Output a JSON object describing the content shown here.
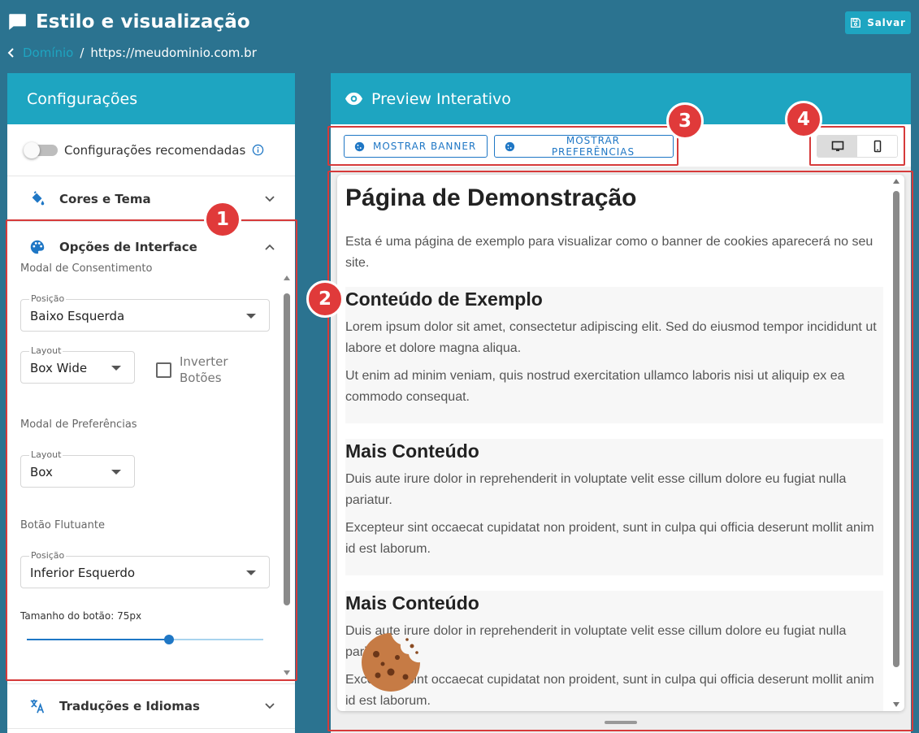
{
  "header": {
    "title": "Estilo e visualização",
    "save_label": "Salvar",
    "breadcrumb": {
      "link": "Domínio",
      "separator": "/",
      "current": "https://meudominio.com.br"
    }
  },
  "config_panel": {
    "title": "Configurações",
    "recommended_label": "Configurações recomendadas",
    "colors_label": "Cores e Tema",
    "interface": {
      "label": "Opções de Interface",
      "consent_modal": {
        "label": "Modal de Consentimento",
        "position_legend": "Posição",
        "position_value": "Baixo Esquerda",
        "layout_legend": "Layout",
        "layout_value": "Box Wide",
        "invert_label_1": "Inverter",
        "invert_label_2": "Botões"
      },
      "preferences_modal": {
        "label": "Modal de Preferências",
        "layout_legend": "Layout",
        "layout_value": "Box"
      },
      "floating_button": {
        "label": "Botão Flutuante",
        "position_legend": "Posição",
        "position_value": "Inferior Esquerdo",
        "size_label": "Tamanho do botão: 75px",
        "size_level": 0.6
      }
    },
    "translations_label": "Traduções e Idiomas"
  },
  "preview_panel": {
    "title": "Preview Interativo",
    "show_banner_label": "MOSTRAR BANNER",
    "show_prefs_label": "MOSTRAR PREFERÊNCIAS",
    "device_active": "desktop"
  },
  "preview_page": {
    "title": "Página de Demonstração",
    "intro": "Esta é uma página de exemplo para visualizar como o banner de cookies aparecerá no seu site.",
    "sections": [
      {
        "heading": "Conteúdo de Exemplo",
        "p1": "Lorem ipsum dolor sit amet, consectetur adipiscing elit. Sed do eiusmod tempor incididunt ut labore et dolore magna aliqua.",
        "p2": "Ut enim ad minim veniam, quis nostrud exercitation ullamco laboris nisi ut aliquip ex ea commodo consequat."
      },
      {
        "heading": "Mais Conteúdo",
        "p1": "Duis aute irure dolor in reprehenderit in voluptate velit esse cillum dolore eu fugiat nulla pariatur.",
        "p2": "Excepteur sint occaecat cupidatat non proident, sunt in culpa qui officia deserunt mollit anim id est laborum."
      },
      {
        "heading": "Mais Conteúdo",
        "p1": "Duis aute irure dolor in reprehenderit in voluptate velit esse cillum dolore eu fugiat nulla pariatur.",
        "p2": "Excepteur sint occaecat cupidatat non proident, sunt in culpa qui officia deserunt mollit anim id est laborum."
      }
    ]
  },
  "annotations": [
    "1",
    "2",
    "3",
    "4"
  ],
  "colors": {
    "background": "#2b7390",
    "accent": "#1ea5c1",
    "primary": "#1f77c5",
    "marker": "#e03a3a"
  }
}
